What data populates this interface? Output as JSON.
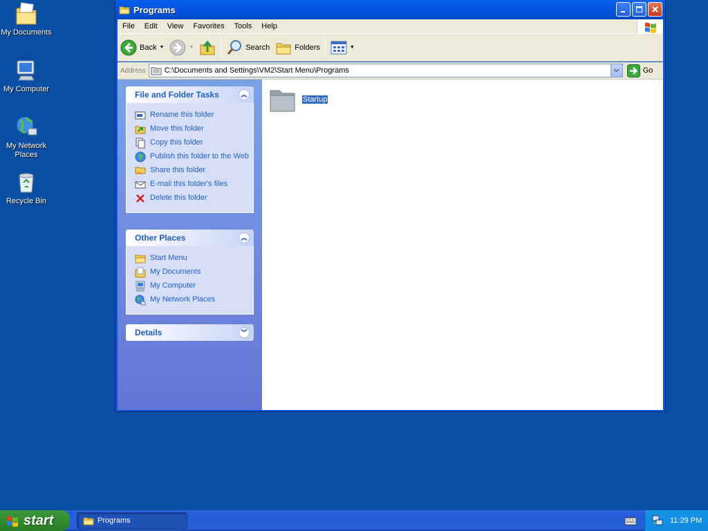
{
  "desktop": {
    "icons": [
      {
        "label": "My Documents"
      },
      {
        "label": "My Computer"
      },
      {
        "label_line1": "My Network",
        "label_line2": "Places"
      },
      {
        "label": "Recycle Bin"
      }
    ]
  },
  "window": {
    "title": "Programs",
    "menu": [
      "File",
      "Edit",
      "View",
      "Favorites",
      "Tools",
      "Help"
    ],
    "toolbar": {
      "back": "Back",
      "search": "Search",
      "folders": "Folders"
    },
    "address": {
      "label": "Address",
      "value": "C:\\Documents and Settings\\VM2\\Start Menu\\Programs",
      "go": "Go"
    },
    "task_pane": {
      "file_tasks": {
        "title": "File and Folder Tasks",
        "items": [
          "Rename this folder",
          "Move this folder",
          "Copy this folder",
          "Publish this folder to the Web",
          "Share this folder",
          "E-mail this folder's files",
          "Delete this folder"
        ]
      },
      "other_places": {
        "title": "Other Places",
        "items": [
          "Start Menu",
          "My Documents",
          "My Computer",
          "My Network Places"
        ]
      },
      "details": {
        "title": "Details"
      }
    },
    "files": [
      {
        "name": "Startup"
      }
    ]
  },
  "taskbar": {
    "start": "start",
    "items": [
      {
        "label": "Programs"
      }
    ],
    "clock": "11:29 PM"
  }
}
